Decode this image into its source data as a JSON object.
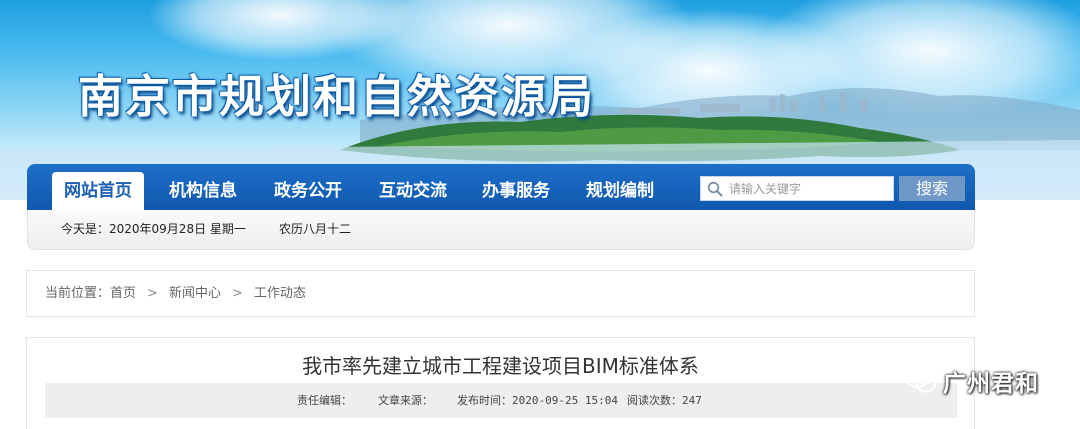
{
  "header": {
    "site_title": "南京市规划和自然资源局"
  },
  "nav": {
    "items": [
      {
        "label": "网站首页",
        "active": true
      },
      {
        "label": "机构信息",
        "active": false
      },
      {
        "label": "政务公开",
        "active": false
      },
      {
        "label": "互动交流",
        "active": false
      },
      {
        "label": "办事服务",
        "active": false
      },
      {
        "label": "规划编制",
        "active": false
      }
    ],
    "search": {
      "placeholder": "请输入关键字",
      "button_label": "搜索"
    },
    "colors": {
      "nav_bar": "#1058ae",
      "active_text": "#1d5fb1",
      "search_button": "#6f97c7"
    }
  },
  "date_bar": {
    "date": "今天是：2020年09月28日 星期一",
    "lunar": "农历八月十二"
  },
  "breadcrumb": {
    "prefix": "当前位置：",
    "items": [
      "首页",
      "新闻中心",
      "工作动态"
    ]
  },
  "article": {
    "title": "我市率先建立城市工程建设项目BIM标准体系",
    "meta": {
      "editor_label": "责任编辑：",
      "source_label": "文章来源：",
      "published": "发布时间：2020-09-25 15:04",
      "reads": "阅读次数：247"
    }
  },
  "watermark": {
    "text": "广州君和",
    "icon": "wechat-icon"
  }
}
